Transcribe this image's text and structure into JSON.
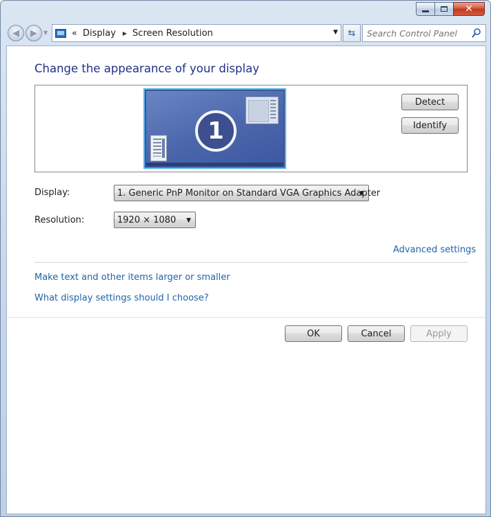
{
  "window": {
    "controls": {
      "minimize_icon": "minimize-icon",
      "maximize_icon": "maximize-icon",
      "close_icon": "close-icon"
    }
  },
  "nav": {
    "back_icon": "back-arrow-icon",
    "forward_icon": "forward-arrow-icon",
    "breadcrumb_prefix": "«",
    "breadcrumb": [
      "Display",
      "Screen Resolution"
    ],
    "search_placeholder": "Search Control Panel"
  },
  "main": {
    "title": "Change the appearance of your display",
    "monitor_number": "1",
    "detect_label": "Detect",
    "identify_label": "Identify",
    "display_label": "Display:",
    "display_value": "1. Generic PnP Monitor on Standard VGA Graphics Adapter",
    "resolution_label": "Resolution:",
    "resolution_value": "1920 × 1080",
    "advanced_link": "Advanced settings",
    "link_text_size": "Make text and other items larger or smaller",
    "link_help": "What display settings should I choose?"
  },
  "footer": {
    "ok_label": "OK",
    "cancel_label": "Cancel",
    "apply_label": "Apply"
  },
  "colors": {
    "title": "#1e3287",
    "link": "#1f63a8",
    "monitor_selected_border": "#5bb3ec"
  }
}
